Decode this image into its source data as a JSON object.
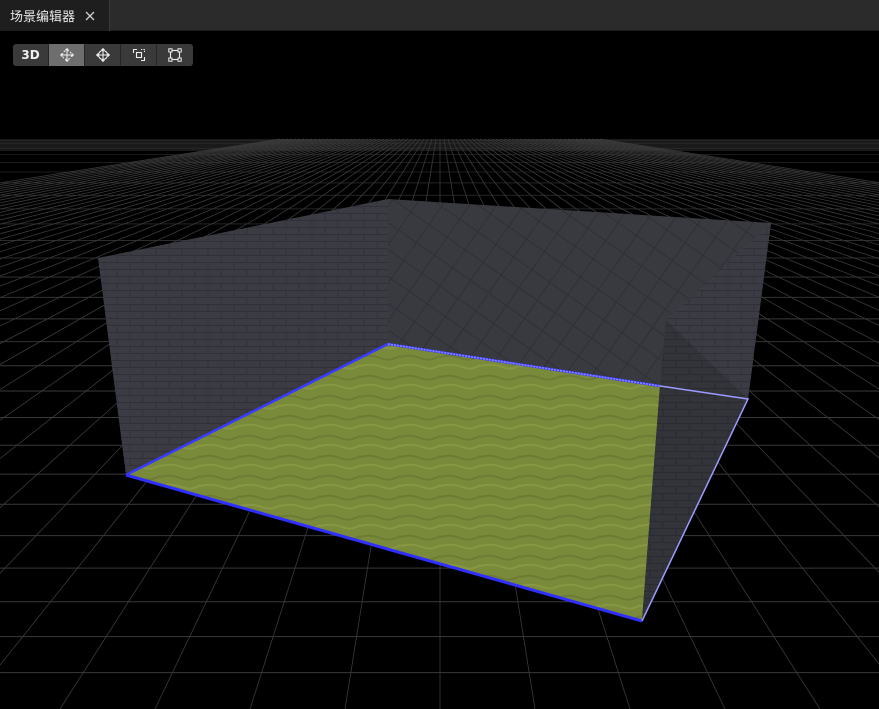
{
  "tab": {
    "title": "场景编辑器",
    "close_icon": "close-icon"
  },
  "toolbar": {
    "mode_label": "3D",
    "tools": [
      {
        "icon": "select-move-icon",
        "active": true
      },
      {
        "icon": "move-icon",
        "active": false
      },
      {
        "icon": "rotate-icon",
        "active": false
      },
      {
        "icon": "scale-icon",
        "active": false
      }
    ]
  },
  "colors": {
    "background": "#000000",
    "grid": "#3a3a3a",
    "wall": "#3c3c44",
    "floor": "#7c8a3a",
    "selection": "#3b3bff"
  }
}
